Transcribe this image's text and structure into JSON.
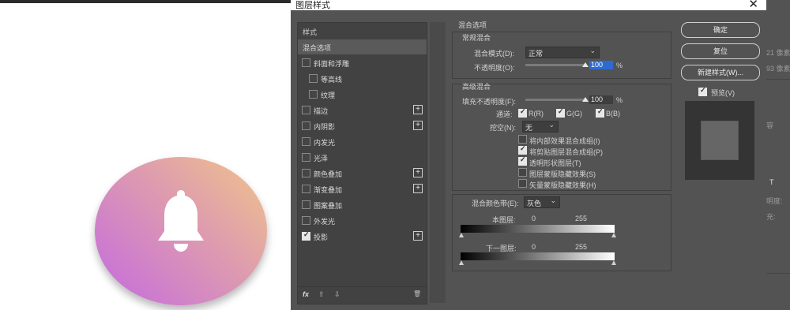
{
  "dialog": {
    "title": "图层样式",
    "close_glyph": "✕"
  },
  "left_panel": {
    "header": "样式",
    "items": [
      {
        "label": "混合选项",
        "selected": true
      },
      {
        "label": "斜面和浮雕",
        "checked": false
      },
      {
        "label": "等高线",
        "checked": false,
        "indent": true
      },
      {
        "label": "纹理",
        "checked": false,
        "indent": true
      },
      {
        "label": "描边",
        "checked": false,
        "plus": true
      },
      {
        "label": "内阴影",
        "checked": false,
        "plus": true
      },
      {
        "label": "内发光",
        "checked": false
      },
      {
        "label": "光泽",
        "checked": false
      },
      {
        "label": "颜色叠加",
        "checked": false,
        "plus": true
      },
      {
        "label": "渐变叠加",
        "checked": false,
        "plus": true
      },
      {
        "label": "图案叠加",
        "checked": false
      },
      {
        "label": "外发光",
        "checked": false
      },
      {
        "label": "投影",
        "checked": true,
        "plus": true
      }
    ],
    "footer": {
      "fx": "fx",
      "up": "⇧",
      "down": "⇩",
      "trash": "🗑"
    }
  },
  "blend_options": {
    "section_title": "混合选项",
    "general": {
      "title": "常规混合",
      "mode_label": "混合模式(D):",
      "mode_value": "正常",
      "opacity_label": "不透明度(O):",
      "opacity_value": "100",
      "percent": "%"
    },
    "advanced": {
      "title": "高级混合",
      "fill_label": "填充不透明度(F):",
      "fill_value": "100",
      "percent": "%",
      "channels_label": "通道:",
      "channel_r": "R(R)",
      "channel_g": "G(G)",
      "channel_b": "B(B)",
      "knockout_label": "挖空(N):",
      "knockout_value": "无",
      "options": [
        {
          "label": "将内部效果混合成组(I)",
          "checked": false
        },
        {
          "label": "将剪贴图层混合成组(P)",
          "checked": true
        },
        {
          "label": "透明形状图层(T)",
          "checked": true
        },
        {
          "label": "图层蒙版隐藏效果(S)",
          "checked": false
        },
        {
          "label": "矢量蒙版隐藏效果(H)",
          "checked": false
        }
      ]
    },
    "blend_if": {
      "label": "混合颜色带(E):",
      "value": "灰色",
      "this_layer": "本图层:",
      "this_min": "0",
      "this_max": "255",
      "under_layer": "下一图层:",
      "under_min": "0",
      "under_max": "255"
    }
  },
  "buttons": {
    "ok": "确定",
    "reset": "复位",
    "new_style": "新建样式(W)...",
    "preview_label": "预览(V)"
  },
  "app_edge": {
    "t1": "21 像素",
    "t2": "93 像素",
    "t3": "容",
    "t4": "T",
    "t5": "明度:",
    "t6": "充:"
  },
  "colors": {
    "gradient_start": "#f0c58a",
    "gradient_mid": "#dd9ab0",
    "gradient_end": "#c46ae0",
    "dialog_bg": "#535353",
    "highlight": "#2d6bd1"
  }
}
